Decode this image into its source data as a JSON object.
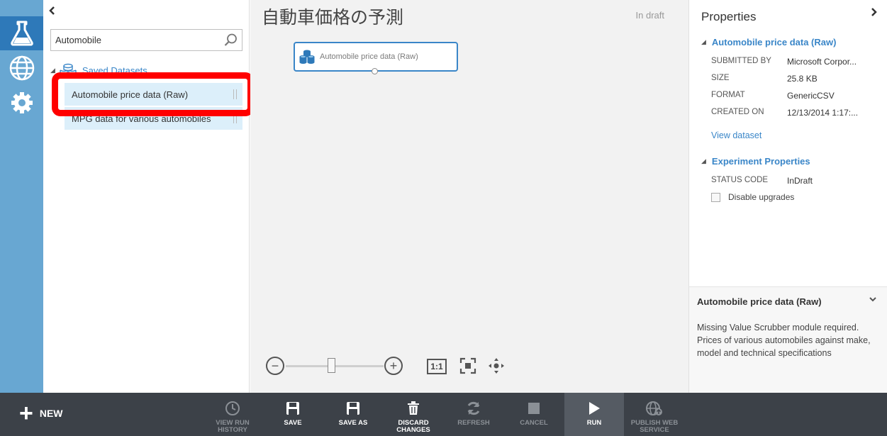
{
  "palette": {
    "search_value": "Automobile",
    "group_label": "Saved Datasets",
    "items": [
      {
        "label": "Automobile price data (Raw)"
      },
      {
        "label": "MPG data for various automobiles"
      }
    ]
  },
  "canvas": {
    "title": "自動車価格の予測",
    "status": "In draft",
    "module_label": "Automobile price data (Raw)",
    "zoom_minus": "−",
    "zoom_plus": "+",
    "fit_label": "1:1"
  },
  "properties": {
    "title": "Properties",
    "section1_title": "Automobile price data (Raw)",
    "rows": [
      {
        "key": "SUBMITTED BY",
        "value": "Microsoft Corpor..."
      },
      {
        "key": "SIZE",
        "value": "25.8 KB"
      },
      {
        "key": "FORMAT",
        "value": "GenericCSV"
      },
      {
        "key": "CREATED ON",
        "value": "12/13/2014 1:17:..."
      }
    ],
    "view_link": "View dataset",
    "section2_title": "Experiment Properties",
    "status_key": "STATUS CODE",
    "status_value": "InDraft",
    "checkbox_label": "Disable upgrades"
  },
  "description": {
    "title": "Automobile price data (Raw)",
    "text": "Missing Value Scrubber module required. Prices of various automobiles against make, model and technical specifications"
  },
  "commandbar": {
    "new_label": "NEW",
    "commands": [
      {
        "label": "VIEW RUN HISTORY",
        "enabled": false
      },
      {
        "label": "SAVE",
        "enabled": true
      },
      {
        "label": "SAVE AS",
        "enabled": true
      },
      {
        "label": "DISCARD CHANGES",
        "enabled": true
      },
      {
        "label": "REFRESH",
        "enabled": false
      },
      {
        "label": "CANCEL",
        "enabled": false
      },
      {
        "label": "RUN",
        "enabled": true
      },
      {
        "label": "PUBLISH WEB SERVICE",
        "enabled": false
      }
    ]
  },
  "icons": {
    "rail": [
      "flask-icon",
      "globe-icon",
      "gear-icon"
    ]
  },
  "colors": {
    "accent": "#3a86c8",
    "rail": "#68a7d2",
    "rail_active": "#2e79b9",
    "annotation": "#ff0000",
    "commandbar": "#3c4148"
  }
}
